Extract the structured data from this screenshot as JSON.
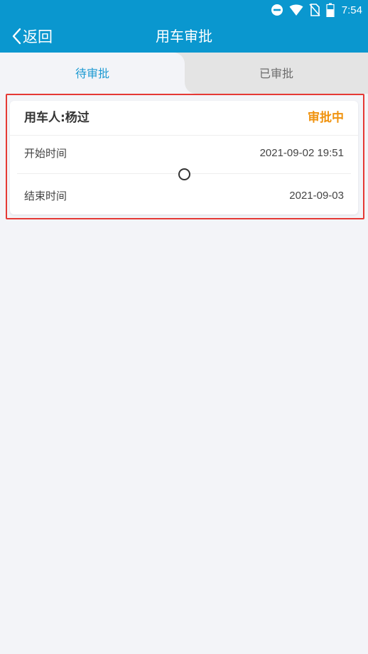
{
  "status_bar": {
    "time": "7:54",
    "icons": [
      "do-not-disturb-icon",
      "wifi-icon",
      "no-sim-icon",
      "battery-icon"
    ]
  },
  "header": {
    "back_label": "返回",
    "title": "用车审批"
  },
  "tabs": [
    {
      "label": "待审批",
      "active": true
    },
    {
      "label": "已审批",
      "active": false
    }
  ],
  "card": {
    "driver": "用车人:杨过",
    "status": "审批中",
    "start_label": "开始时间",
    "start_value": "2021-09-02 19:51",
    "end_label": "结束时间",
    "end_value": "2021-09-03"
  },
  "colors": {
    "header_bg": "#0a97cf",
    "active_tab": "#1d9ad2",
    "status_pending": "#f0930f",
    "highlight_border": "#e53935",
    "page_bg": "#f3f4f8"
  }
}
